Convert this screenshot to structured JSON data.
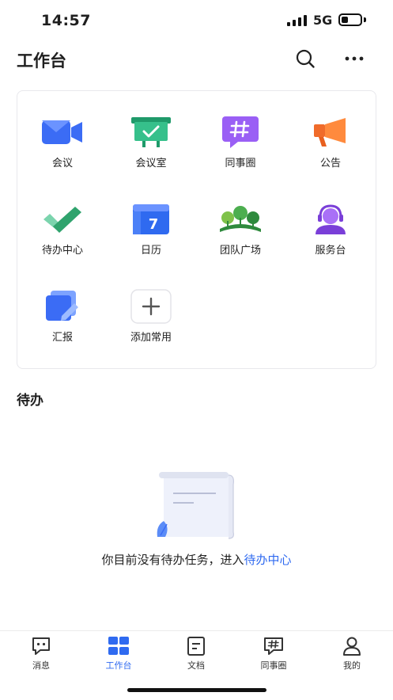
{
  "status_bar": {
    "time": "14:57",
    "network": "5G",
    "battery_level": 0.35
  },
  "header": {
    "title": "工作台",
    "search_icon": "search-icon",
    "more_icon": "more-icon"
  },
  "apps": [
    {
      "label": "会议",
      "icon": "video-camera-icon"
    },
    {
      "label": "会议室",
      "icon": "meeting-room-icon"
    },
    {
      "label": "同事圈",
      "icon": "hashtag-chat-icon"
    },
    {
      "label": "公告",
      "icon": "megaphone-icon"
    },
    {
      "label": "待办中心",
      "icon": "checkmark-icon"
    },
    {
      "label": "日历",
      "icon": "calendar-icon"
    },
    {
      "label": "团队广场",
      "icon": "team-plaza-icon"
    },
    {
      "label": "服务台",
      "icon": "headset-agent-icon"
    },
    {
      "label": "汇报",
      "icon": "report-edit-icon"
    },
    {
      "label": "添加常用",
      "icon": "plus-icon"
    }
  ],
  "calendar_day": "7",
  "todo": {
    "section_title": "待办",
    "empty_text": "你目前没有待办任务，进入",
    "empty_link": "待办中心"
  },
  "tabbar": {
    "tabs": [
      {
        "label": "消息",
        "icon": "message-icon",
        "active": false
      },
      {
        "label": "工作台",
        "icon": "workbench-grid-icon",
        "active": true
      },
      {
        "label": "文档",
        "icon": "document-icon",
        "active": false
      },
      {
        "label": "同事圈",
        "icon": "hashtag-chat-icon",
        "active": false
      },
      {
        "label": "我的",
        "icon": "user-icon",
        "active": false
      }
    ]
  },
  "colors": {
    "accent": "#2f6af0",
    "active_tab": "#2f6af0"
  }
}
